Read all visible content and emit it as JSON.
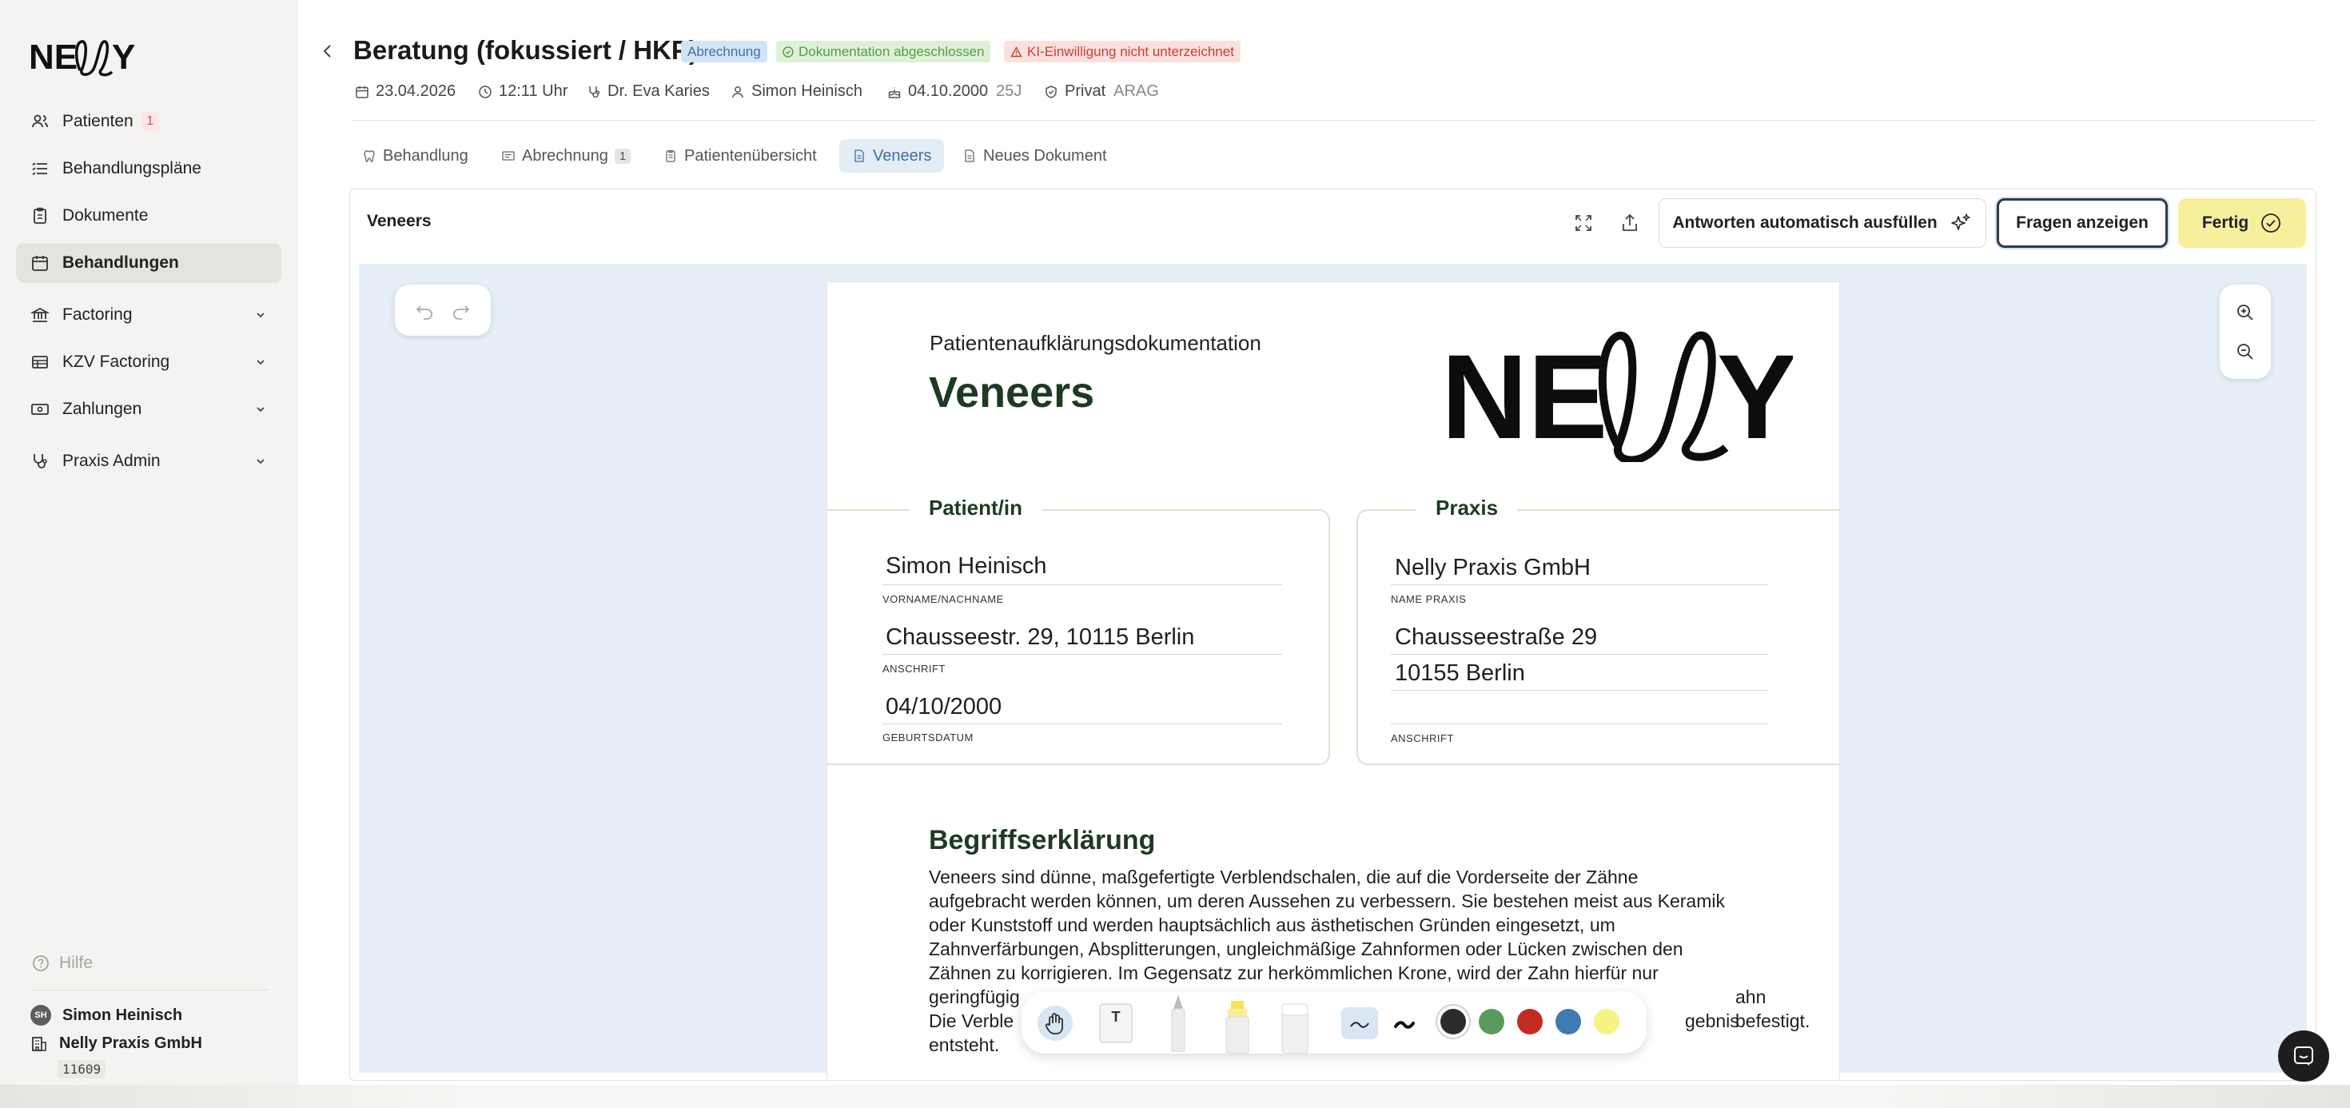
{
  "sidebar": {
    "logo_text": "NELLY",
    "items": [
      {
        "label": "Patienten",
        "badge": "1"
      },
      {
        "label": "Behandlungspläne"
      },
      {
        "label": "Dokumente"
      },
      {
        "label": "Behandlungen"
      },
      {
        "label": "Factoring"
      },
      {
        "label": "KZV Factoring"
      },
      {
        "label": "Zahlungen"
      },
      {
        "label": "Praxis Admin"
      }
    ],
    "active_item": "Behandlungen",
    "help_label": "Hilfe",
    "user": {
      "initials": "SH",
      "name": "Simon Heinisch"
    },
    "practice": {
      "name": "Nelly Praxis GmbH",
      "id": "11609"
    }
  },
  "header": {
    "title": "Beratung (fokussiert / HKP)",
    "badges": {
      "billing": "Abrechnung",
      "documentation": "Dokumentation abgeschlossen",
      "ai_consent": "KI-Einwilligung nicht unterzeichnet"
    },
    "meta": {
      "date": "23.04.2026",
      "time": "12:11 Uhr",
      "doctor": "Dr. Eva Karies",
      "patient": "Simon Heinisch",
      "birthdate": "04.10.2000",
      "age": "25J",
      "insurance_type": "Privat",
      "insurer": "ARAG"
    }
  },
  "tabs": [
    {
      "label": "Behandlung"
    },
    {
      "label": "Abrechnung",
      "count": "1"
    },
    {
      "label": "Patientenübersicht"
    },
    {
      "label": "Veneers"
    },
    {
      "label": "Neues Dokument"
    }
  ],
  "active_tab": "Veneers",
  "panel": {
    "title": "Veneers",
    "autofill_label": "Antworten automatisch ausfüllen",
    "questions_label": "Fragen anzeigen",
    "done_label": "Fertig"
  },
  "document": {
    "subtitle": "Patientenaufklärungsdokumentation",
    "title": "Veneers",
    "logo_text": "NELLY",
    "patient_section": {
      "heading": "Patient/in",
      "name": "Simon Heinisch",
      "name_label": "VORNAME/NACHNAME",
      "address": "Chausseestr. 29, 10115 Berlin",
      "address_label": "ANSCHRIFT",
      "birthdate": "04/10/2000",
      "birthdate_label": "GEBURTSDATUM"
    },
    "practice_section": {
      "heading": "Praxis",
      "name": "Nelly Praxis GmbH",
      "name_label": "NAME PRAXIS",
      "street": "Chausseestraße 29",
      "city": "10155 Berlin",
      "address_label": "ANSCHRIFT"
    },
    "section_heading": "Begriffserklärung",
    "section_lines": [
      "Veneers sind dünne, maßgefertigte Verblendschalen, die auf die Vorderseite der Zähne",
      "aufgebracht werden können, um deren Aussehen zu verbessern. Sie bestehen meist aus Keramik",
      "oder Kunststoff und werden hauptsächlich aus ästhetischen Gründen eingesetzt, um",
      "Zahnverfärbungen, Absplitterungen, ungleichmäßige Zahnformen oder Lücken zwischen den",
      "Zähnen zu korrigieren. Im Gegensatz zur herkömmlichen Krone, wird der Zahn hierfür nur",
      "geringfügig",
      "Die Verble",
      "entsteht."
    ],
    "section_line_tail_6": "ahn befestigt.",
    "section_line_tail_7": "gebnis"
  },
  "draw_toolbar": {
    "colors": [
      "#2b2b2b",
      "#5a9a5c",
      "#c22b22",
      "#3f7ab4",
      "#f7f383"
    ],
    "selected_color": "#2b2b2b"
  }
}
